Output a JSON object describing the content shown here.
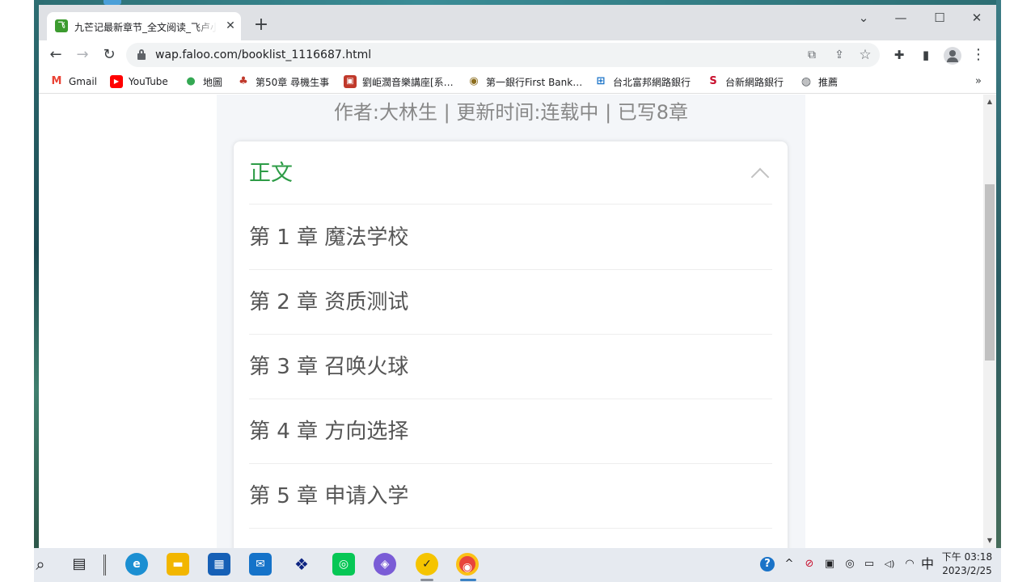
{
  "browser": {
    "tab_title": "九芒记最新章节_全文阅读_飞卢小说网",
    "tab_favicon_text": "飞",
    "tab_close": "✕",
    "new_tab": "+",
    "window_controls": {
      "dropdown": "⌄",
      "minimize": "—",
      "maximize": "☐",
      "close": "✕"
    },
    "nav": {
      "back": "←",
      "forward": "→",
      "reload": "↻"
    },
    "url": "wap.faloo.com/booklist_1116687.html",
    "omnibox_icons": {
      "translate": "⧉",
      "share": "⇪",
      "bookmark_star": "☆"
    },
    "toolbar_icons": {
      "extensions": "✚",
      "side_panel": "▮",
      "menu": "⋮"
    },
    "bookmarks": [
      {
        "label": "Gmail",
        "icon": "gmail-icon",
        "icon_text": "M",
        "color": "#ea4335"
      },
      {
        "label": "YouTube",
        "icon": "youtube-icon",
        "icon_text": "▶",
        "color": "#ff0000"
      },
      {
        "label": "地圖",
        "icon": "maps-pin-icon",
        "icon_text": "●",
        "color": "#34a853"
      },
      {
        "label": "第50章 尋機生事",
        "icon": "book-icon",
        "icon_text": "♣",
        "color": "#c0392b"
      },
      {
        "label": "劉岠濶音樂講座[系…",
        "icon": "music-lecture-icon",
        "icon_text": "▣",
        "color": "#c0392b"
      },
      {
        "label": "第一銀行First Bank…",
        "icon": "first-bank-icon",
        "icon_text": "◉",
        "color": "#8d6e1f"
      },
      {
        "label": "台北富邦網路銀行",
        "icon": "fubon-bank-icon",
        "icon_text": "⊞",
        "color": "#1a73c8"
      },
      {
        "label": "台新網路銀行",
        "icon": "taishin-bank-icon",
        "icon_text": "S",
        "color": "#c8102e"
      },
      {
        "label": "推薦",
        "icon": "globe-icon",
        "icon_text": "◍",
        "color": "#5f6368"
      }
    ],
    "bookmarks_more": "»"
  },
  "page": {
    "meta_line": "作者:大林生 | 更新时间:连载中 | 已写8章",
    "section_title": "正文",
    "chapters": [
      "第 1 章 魔法学校",
      "第 2 章 资质测试",
      "第 3 章 召唤火球",
      "第 4 章 方向选择",
      "第 5 章 申请入学"
    ]
  },
  "scrollbar": {
    "up": "▲",
    "down": "▼",
    "scroll_fraction": 0.2
  },
  "taskbar": {
    "search": "⌕",
    "task_view": "▤",
    "apps": [
      {
        "name": "edge-icon",
        "glyph": "e",
        "color": "#1b8fd2"
      },
      {
        "name": "file-explorer-icon",
        "glyph": "▬",
        "color": "#f2b600"
      },
      {
        "name": "microsoft-store-icon",
        "glyph": "▦",
        "color": "#1660b6"
      },
      {
        "name": "mail-icon",
        "glyph": "✉",
        "color": "#1573c9"
      },
      {
        "name": "dropbox-icon",
        "glyph": "❖",
        "color": "#0d2481"
      },
      {
        "name": "line-app-icon",
        "glyph": "◎",
        "color": "#06c755"
      },
      {
        "name": "copilot-icon",
        "glyph": "◈",
        "color": "#7a5cd6"
      },
      {
        "name": "norton-icon",
        "glyph": "✓",
        "color": "#f5c400"
      },
      {
        "name": "chrome-icon",
        "glyph": "◉",
        "color": "#e8453c"
      }
    ],
    "tray": {
      "help": "?",
      "chevron": "^",
      "network_off": "⊘",
      "display": "▣",
      "meet": "◎",
      "battery": "▭",
      "volume": "◁)",
      "wifi": "◠",
      "ime": "中"
    },
    "clock_time": "下午 03:18",
    "clock_date": "2023/2/25"
  }
}
